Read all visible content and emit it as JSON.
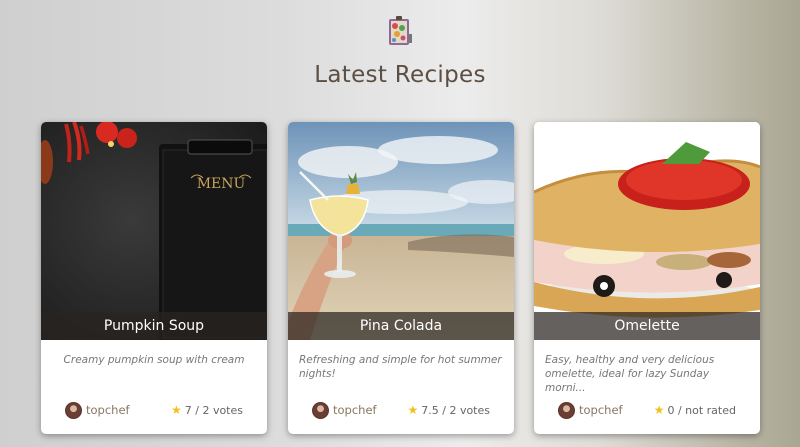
{
  "page": {
    "title": "Latest Recipes"
  },
  "colors": {
    "title_text": "#5b4f44",
    "author_text": "#8a7560",
    "star": "#f3c21a",
    "title_bar": "#28241f"
  },
  "icons": {
    "logo": "recipe-book-icon",
    "star": "star-icon",
    "avatar": "chef-avatar"
  },
  "recipes": [
    {
      "title": "Pumpkin Soup",
      "description": "Creamy pumpkin soup with cream",
      "author": "topchef",
      "rating": "7 / 2 votes",
      "image": "menu-board-photo"
    },
    {
      "title": "Pina Colada",
      "description": "Refreshing and simple for hot summer nights!",
      "author": "topchef",
      "rating": "7.5 / 2 votes",
      "image": "beach-cocktail-photo"
    },
    {
      "title": "Omelette",
      "description": "Easy, healthy and very delicious omelette, ideal for lazy Sunday morni...",
      "author": "topchef",
      "rating": "0 / not rated",
      "image": "omelette-photo"
    }
  ]
}
